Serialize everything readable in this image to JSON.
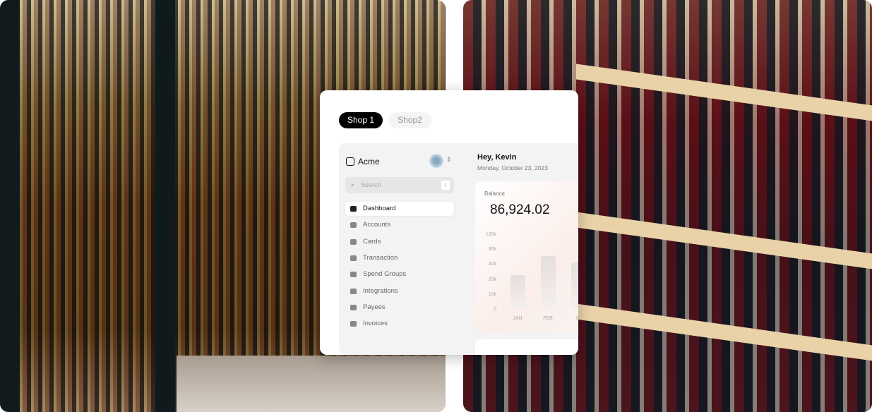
{
  "tabs": [
    {
      "label": "Shop 1",
      "active": true
    },
    {
      "label": "Shop2",
      "active": false
    }
  ],
  "sidebar": {
    "brand": "Acme",
    "search_placeholder": "Search",
    "search_shortcut": "/",
    "items": [
      {
        "label": "Dashboard",
        "icon": "home-icon",
        "active": true
      },
      {
        "label": "Accounts",
        "icon": "users-icon"
      },
      {
        "label": "Cards",
        "icon": "card-icon"
      },
      {
        "label": "Transaction",
        "icon": "pie-chart-icon"
      },
      {
        "label": "Spend Groups",
        "icon": "tag-icon"
      },
      {
        "label": "Integrations",
        "icon": "grid-icon"
      },
      {
        "label": "Payees",
        "icon": "contact-icon"
      },
      {
        "label": "Invoices",
        "icon": "archive-icon"
      }
    ]
  },
  "main": {
    "greeting": "Hey, Kevin",
    "date": "Monday, October 23, 2023",
    "balance_label": "Balance",
    "balance_value": "86,924.02"
  },
  "chart_data": {
    "type": "bar",
    "categories": [
      "JAN",
      "FEB",
      "M"
    ],
    "values": [
      26000,
      62000,
      45000
    ],
    "yticks": [
      "120k",
      "80k",
      "40k",
      "20k",
      "10k",
      "0"
    ],
    "ytick_values": [
      120000,
      80000,
      40000,
      20000,
      10000,
      0
    ],
    "grid": false
  }
}
